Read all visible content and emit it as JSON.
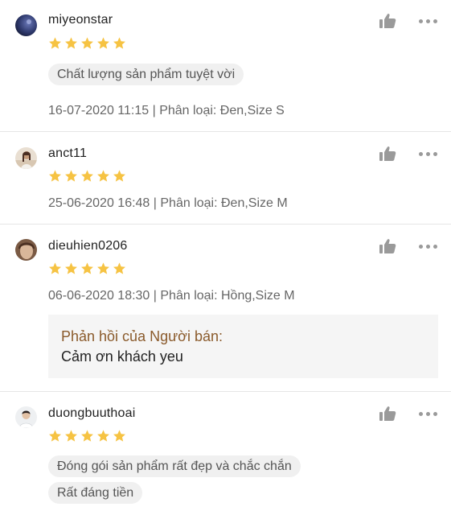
{
  "colors": {
    "star": "#f6c343",
    "reply_title": "#8a5a2b",
    "tag_bg": "#f0f0f0",
    "divider": "#e6e6e6"
  },
  "icons": {
    "like": "thumbs-up-icon",
    "more": "more-dots-icon"
  },
  "reviews": [
    {
      "username": "miyeonstar",
      "rating": 5,
      "tags": [
        "Chất lượng sản phẩm tuyệt vời"
      ],
      "meta": "16-07-2020 11:15 | Phân loại: Đen,Size S"
    },
    {
      "username": "anct11",
      "rating": 5,
      "meta": "25-06-2020 16:48 | Phân loại: Đen,Size M"
    },
    {
      "username": "dieuhien0206",
      "rating": 5,
      "meta": "06-06-2020 18:30 | Phân loại: Hồng,Size M",
      "reply": {
        "title": "Phản hồi của Người bán:",
        "text": "Cảm ơn khách yeu"
      }
    },
    {
      "username": "duongbuuthoai",
      "rating": 5,
      "tags": [
        "Đóng gói sản phẩm rất đẹp và chắc chắn",
        "Rất đáng tiền"
      ]
    }
  ]
}
